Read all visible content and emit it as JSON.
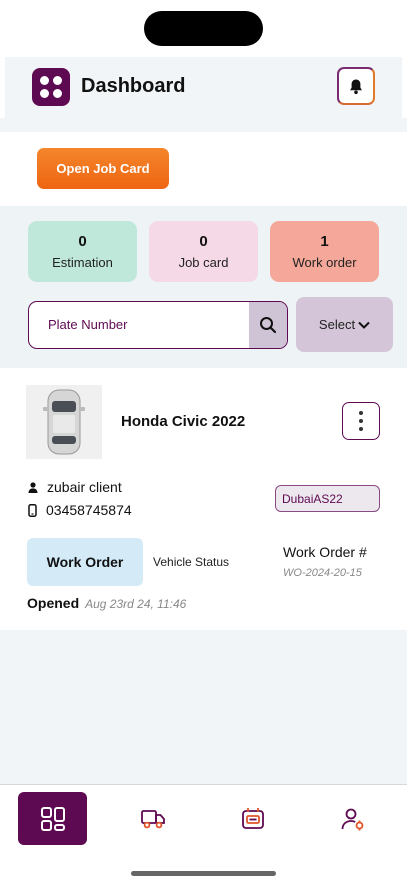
{
  "header": {
    "title": "Dashboard",
    "logo_icon": "grid-dots-icon",
    "notification_icon": "bell-icon"
  },
  "actions": {
    "open_job_card_label": "Open Job Card"
  },
  "stats": [
    {
      "value": "0",
      "label": "Estimation",
      "color": "#bfe8db"
    },
    {
      "value": "0",
      "label": "Job card",
      "color": "#f6d9e6"
    },
    {
      "value": "1",
      "label": "Work order",
      "color": "#f5a899"
    }
  ],
  "search": {
    "placeholder": "Plate Number",
    "select_label": "Select"
  },
  "job": {
    "car_name": "Honda Civic 2022",
    "client_name": "zubair client",
    "phone": "03458745874",
    "plate": "DubaiAS22",
    "status_label": "Work Order",
    "vehicle_status_label": "Vehicle Status",
    "work_order_label": "Work Order #",
    "work_order_number": "WO-2024-20-15",
    "opened_label": "Opened",
    "opened_date": "Aug 23rd 24, 11:46"
  },
  "tabbar": {
    "active": "dashboard",
    "icons": [
      "dashboard-icon",
      "truck-icon",
      "job-card-icon",
      "profile-settings-icon"
    ]
  },
  "colors": {
    "brand": "#5e0a52",
    "accent": "#f27a1f"
  }
}
